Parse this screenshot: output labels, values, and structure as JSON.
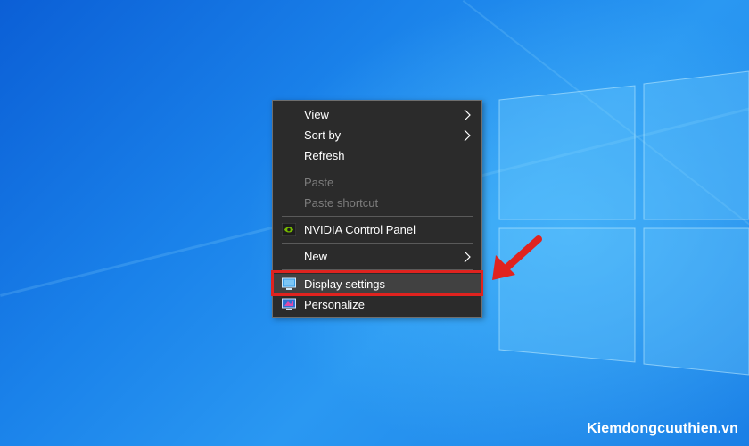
{
  "context_menu": {
    "items": [
      {
        "label": "View",
        "submenu": true,
        "disabled": false
      },
      {
        "label": "Sort by",
        "submenu": true,
        "disabled": false
      },
      {
        "label": "Refresh",
        "submenu": false,
        "disabled": false
      },
      {
        "label": "Paste",
        "submenu": false,
        "disabled": true
      },
      {
        "label": "Paste shortcut",
        "submenu": false,
        "disabled": true
      },
      {
        "label": "NVIDIA Control Panel",
        "icon": "nvidia-icon",
        "submenu": false,
        "disabled": false
      },
      {
        "label": "New",
        "submenu": true,
        "disabled": false
      },
      {
        "label": "Display settings",
        "icon": "display-icon",
        "submenu": false,
        "disabled": false,
        "highlighted": true
      },
      {
        "label": "Personalize",
        "icon": "personalize-icon",
        "submenu": false,
        "disabled": false
      }
    ]
  },
  "annotation": {
    "color": "#e0231f",
    "target": "Display settings"
  },
  "watermark": "Kiemdongcuuthien.vn",
  "colors": {
    "desktop": "#1a82ea",
    "menu_bg": "#2b2b2b",
    "menu_hover": "#414141"
  }
}
